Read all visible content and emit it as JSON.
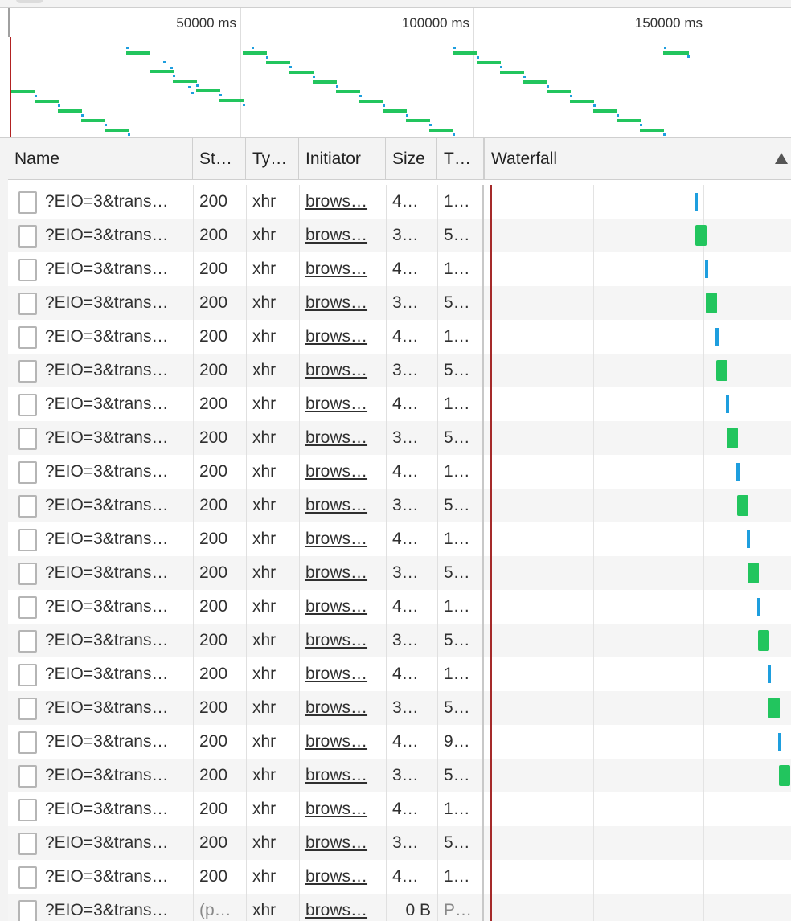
{
  "overview": {
    "ticks": [
      "50000 ms",
      "100000 ms",
      "150000 ms"
    ]
  },
  "columns": {
    "name": "Name",
    "status": "St…",
    "type": "Ty…",
    "initiator": "Initiator",
    "size": "Size",
    "time": "T…",
    "waterfall": "Waterfall"
  },
  "rows": [
    {
      "name": "?EIO=3&trans…",
      "status": "200",
      "type": "xhr",
      "initiator": "brows…",
      "size": "4…",
      "time": "1…",
      "wf": "wait"
    },
    {
      "name": "?EIO=3&trans…",
      "status": "200",
      "type": "xhr",
      "initiator": "brows…",
      "size": "3…",
      "time": "5…",
      "wf": "recv"
    },
    {
      "name": "?EIO=3&trans…",
      "status": "200",
      "type": "xhr",
      "initiator": "brows…",
      "size": "4…",
      "time": "1…",
      "wf": "wait"
    },
    {
      "name": "?EIO=3&trans…",
      "status": "200",
      "type": "xhr",
      "initiator": "brows…",
      "size": "3…",
      "time": "5…",
      "wf": "recv"
    },
    {
      "name": "?EIO=3&trans…",
      "status": "200",
      "type": "xhr",
      "initiator": "brows…",
      "size": "4…",
      "time": "1…",
      "wf": "wait"
    },
    {
      "name": "?EIO=3&trans…",
      "status": "200",
      "type": "xhr",
      "initiator": "brows…",
      "size": "3…",
      "time": "5…",
      "wf": "recv"
    },
    {
      "name": "?EIO=3&trans…",
      "status": "200",
      "type": "xhr",
      "initiator": "brows…",
      "size": "4…",
      "time": "1…",
      "wf": "wait"
    },
    {
      "name": "?EIO=3&trans…",
      "status": "200",
      "type": "xhr",
      "initiator": "brows…",
      "size": "3…",
      "time": "5…",
      "wf": "recv"
    },
    {
      "name": "?EIO=3&trans…",
      "status": "200",
      "type": "xhr",
      "initiator": "brows…",
      "size": "4…",
      "time": "1…",
      "wf": "wait"
    },
    {
      "name": "?EIO=3&trans…",
      "status": "200",
      "type": "xhr",
      "initiator": "brows…",
      "size": "3…",
      "time": "5…",
      "wf": "recv"
    },
    {
      "name": "?EIO=3&trans…",
      "status": "200",
      "type": "xhr",
      "initiator": "brows…",
      "size": "4…",
      "time": "1…",
      "wf": "wait"
    },
    {
      "name": "?EIO=3&trans…",
      "status": "200",
      "type": "xhr",
      "initiator": "brows…",
      "size": "3…",
      "time": "5…",
      "wf": "recv"
    },
    {
      "name": "?EIO=3&trans…",
      "status": "200",
      "type": "xhr",
      "initiator": "brows…",
      "size": "4…",
      "time": "1…",
      "wf": "wait"
    },
    {
      "name": "?EIO=3&trans…",
      "status": "200",
      "type": "xhr",
      "initiator": "brows…",
      "size": "3…",
      "time": "5…",
      "wf": "recv"
    },
    {
      "name": "?EIO=3&trans…",
      "status": "200",
      "type": "xhr",
      "initiator": "brows…",
      "size": "4…",
      "time": "1…",
      "wf": "wait"
    },
    {
      "name": "?EIO=3&trans…",
      "status": "200",
      "type": "xhr",
      "initiator": "brows…",
      "size": "3…",
      "time": "5…",
      "wf": "recv"
    },
    {
      "name": "?EIO=3&trans…",
      "status": "200",
      "type": "xhr",
      "initiator": "brows…",
      "size": "4…",
      "time": "9…",
      "wf": "wait"
    },
    {
      "name": "?EIO=3&trans…",
      "status": "200",
      "type": "xhr",
      "initiator": "brows…",
      "size": "3…",
      "time": "5…",
      "wf": "recv"
    },
    {
      "name": "?EIO=3&trans…",
      "status": "200",
      "type": "xhr",
      "initiator": "brows…",
      "size": "4…",
      "time": "1…",
      "wf": "none"
    },
    {
      "name": "?EIO=3&trans…",
      "status": "200",
      "type": "xhr",
      "initiator": "brows…",
      "size": "3…",
      "time": "5…",
      "wf": "none"
    },
    {
      "name": "?EIO=3&trans…",
      "status": "200",
      "type": "xhr",
      "initiator": "brows…",
      "size": "4…",
      "time": "1…",
      "wf": "none"
    },
    {
      "name": "?EIO=3&trans…",
      "status": "(p…",
      "type": "xhr",
      "initiator": "brows…",
      "size": "0 B",
      "time": "P…",
      "wf": "none",
      "pending": true
    }
  ],
  "colors": {
    "receiving": "#22c55e",
    "waiting": "#1e9ede",
    "load_line": "#a52a2a"
  }
}
